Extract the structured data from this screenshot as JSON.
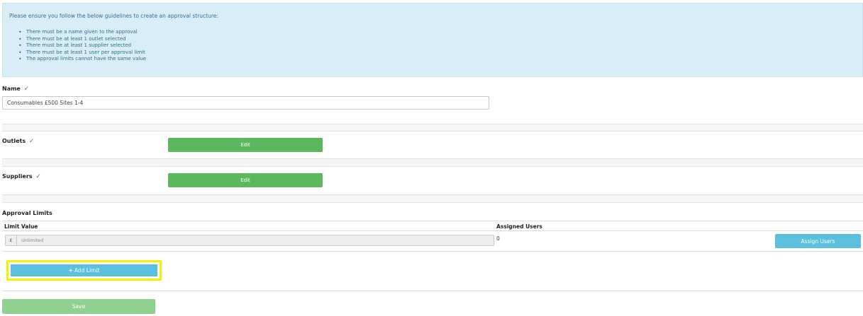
{
  "info": {
    "intro": "Please ensure you follow the below guidelines to create an approval structure:",
    "rules": [
      "There must be a name given to the approval",
      "There must be at least 1 outlet selected",
      "There must be at least 1 supplier selected",
      "There must be at least 1 user per approval limit",
      "The approval limits cannot have the same value"
    ]
  },
  "name": {
    "label": "Name",
    "check": "✓",
    "value": "Consumables £500  Sites 1-4"
  },
  "outlets": {
    "label": "Outlets",
    "check": "✓",
    "edit_label": "Edit"
  },
  "suppliers": {
    "label": "Suppliers",
    "check": "✓",
    "edit_label": "Edit"
  },
  "approval_limits": {
    "title": "Approval Limits",
    "columns": [
      "Limit Value",
      "Assigned Users"
    ],
    "rows": [
      {
        "currency": "£",
        "limit_placeholder": "Unlimited",
        "assigned_users": "0",
        "assign_label": "Assign Users"
      }
    ],
    "add_limit_label": "Add Limit",
    "add_icon": "plus-icon"
  },
  "save_label": "Save",
  "colors": {
    "info_bg": "#d9edf7",
    "info_text": "#31708f",
    "success": "#5cb85c",
    "info_button": "#5bc0de",
    "save_disabled": "#8fd18f",
    "highlight": "#f2f200",
    "check": "#3c8d3c"
  }
}
